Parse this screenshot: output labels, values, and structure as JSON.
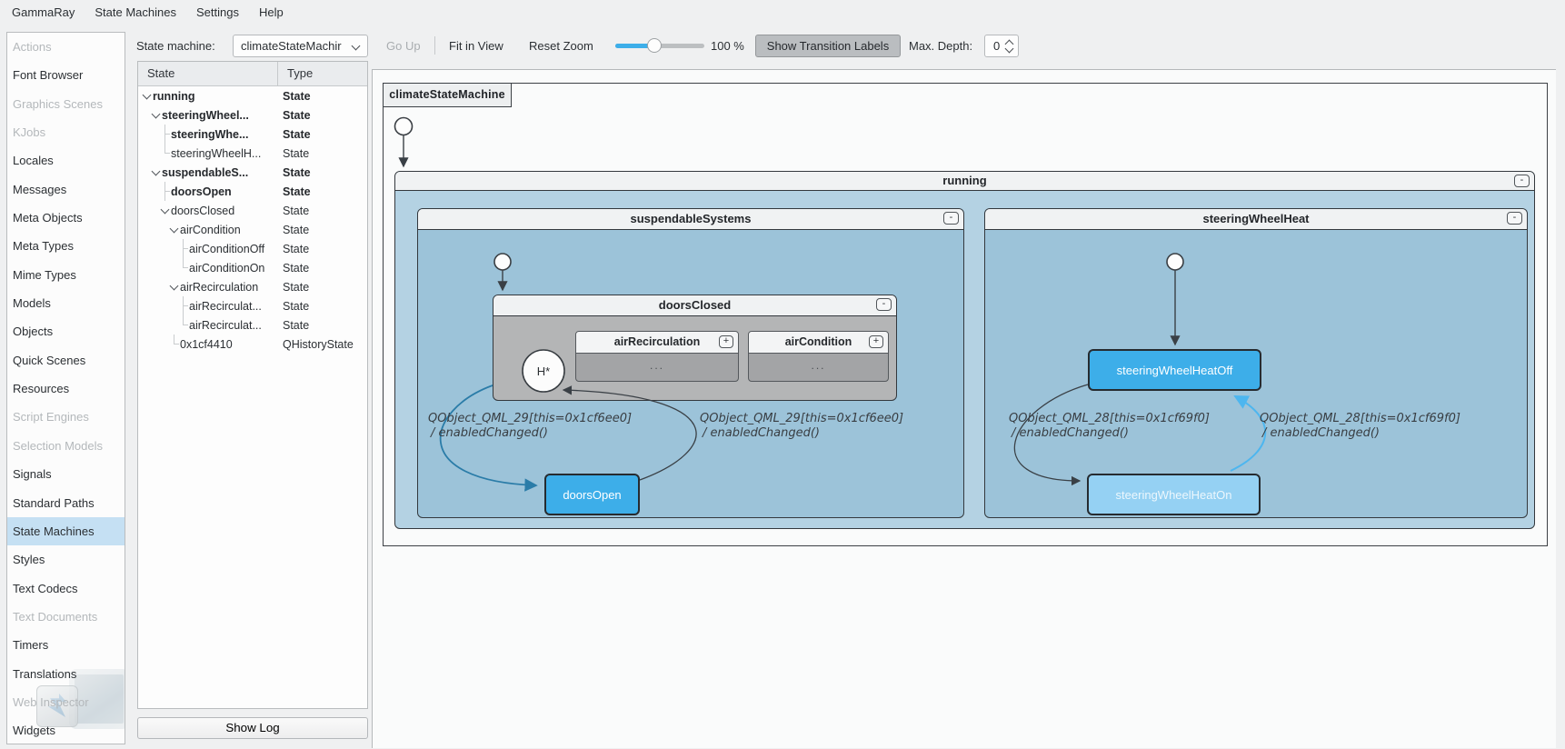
{
  "menubar": {
    "items": [
      {
        "label": "GammaRay"
      },
      {
        "label": "State Machines"
      },
      {
        "label": "Settings"
      },
      {
        "label": "Help"
      }
    ]
  },
  "sidebar": {
    "items": [
      {
        "label": "Actions",
        "enabled": false,
        "selected": false
      },
      {
        "label": "Font Browser",
        "enabled": true,
        "selected": false
      },
      {
        "label": "Graphics Scenes",
        "enabled": false,
        "selected": false
      },
      {
        "label": "KJobs",
        "enabled": false,
        "selected": false
      },
      {
        "label": "Locales",
        "enabled": true,
        "selected": false
      },
      {
        "label": "Messages",
        "enabled": true,
        "selected": false
      },
      {
        "label": "Meta Objects",
        "enabled": true,
        "selected": false
      },
      {
        "label": "Meta Types",
        "enabled": true,
        "selected": false
      },
      {
        "label": "Mime Types",
        "enabled": true,
        "selected": false
      },
      {
        "label": "Models",
        "enabled": true,
        "selected": false
      },
      {
        "label": "Objects",
        "enabled": true,
        "selected": false
      },
      {
        "label": "Quick Scenes",
        "enabled": true,
        "selected": false
      },
      {
        "label": "Resources",
        "enabled": true,
        "selected": false
      },
      {
        "label": "Script Engines",
        "enabled": false,
        "selected": false
      },
      {
        "label": "Selection Models",
        "enabled": false,
        "selected": false
      },
      {
        "label": "Signals",
        "enabled": true,
        "selected": false
      },
      {
        "label": "Standard Paths",
        "enabled": true,
        "selected": false
      },
      {
        "label": "State Machines",
        "enabled": true,
        "selected": true
      },
      {
        "label": "Styles",
        "enabled": true,
        "selected": false
      },
      {
        "label": "Text Codecs",
        "enabled": true,
        "selected": false
      },
      {
        "label": "Text Documents",
        "enabled": false,
        "selected": false
      },
      {
        "label": "Timers",
        "enabled": true,
        "selected": false
      },
      {
        "label": "Translations",
        "enabled": true,
        "selected": false
      },
      {
        "label": "Web Inspector",
        "enabled": false,
        "selected": false
      },
      {
        "label": "Widgets",
        "enabled": true,
        "selected": false
      }
    ]
  },
  "statepanel": {
    "combo_label": "State machine:",
    "combo_value": "climateStateMachir",
    "columns": {
      "state": "State",
      "type": "Type"
    },
    "rows": [
      {
        "label": "running",
        "type": "State",
        "depth": 0,
        "bold": true,
        "marker": "chev"
      },
      {
        "label": "steeringWheel...",
        "type": "State",
        "depth": 1,
        "bold": true,
        "marker": "chev"
      },
      {
        "label": "steeringWhe...",
        "type": "State",
        "depth": 2,
        "bold": true,
        "marker": "tee"
      },
      {
        "label": "steeringWheelH...",
        "type": "State",
        "depth": 2,
        "bold": false,
        "marker": "end"
      },
      {
        "label": "suspendableS...",
        "type": "State",
        "depth": 1,
        "bold": true,
        "marker": "chev"
      },
      {
        "label": "doorsOpen",
        "type": "State",
        "depth": 2,
        "bold": true,
        "marker": "tee"
      },
      {
        "label": "doorsClosed",
        "type": "State",
        "depth": 2,
        "bold": false,
        "marker": "chev"
      },
      {
        "label": "airCondition",
        "type": "State",
        "depth": 3,
        "bold": false,
        "marker": "chev"
      },
      {
        "label": "airConditionOff",
        "type": "State",
        "depth": 4,
        "bold": false,
        "marker": "tee"
      },
      {
        "label": "airConditionOn",
        "type": "State",
        "depth": 4,
        "bold": false,
        "marker": "end"
      },
      {
        "label": "airRecirculation",
        "type": "State",
        "depth": 3,
        "bold": false,
        "marker": "chev"
      },
      {
        "label": "airRecirculat...",
        "type": "State",
        "depth": 4,
        "bold": false,
        "marker": "tee"
      },
      {
        "label": "airRecirculat...",
        "type": "State",
        "depth": 4,
        "bold": false,
        "marker": "end"
      },
      {
        "label": "0x1cf4410",
        "type": "QHistoryState",
        "depth": 3,
        "bold": false,
        "marker": "end"
      }
    ],
    "show_log": "Show Log"
  },
  "toolbar": {
    "go_up": "Go Up",
    "fit_in_view": "Fit in View",
    "reset_zoom": "Reset Zoom",
    "zoom_value": "100 %",
    "show_transition_labels": "Show Transition Labels",
    "max_depth_label": "Max. Depth:",
    "max_depth_value": "0"
  },
  "diagram": {
    "machine_title": "climateStateMachine",
    "collapse_glyph": "-",
    "expand_glyph": "+",
    "ellipsis": "...",
    "states": {
      "running": "running",
      "suspendable": "suspendableSystems",
      "steering": "steeringWheelHeat",
      "doors_closed": "doorsClosed",
      "air_recirculation": "airRecirculation",
      "air_condition": "airCondition",
      "doors_open": "doorsOpen",
      "heat_off": "steeringWheelHeatOff",
      "heat_on": "steeringWheelHeatOn",
      "history": "H*"
    },
    "transitions": {
      "doors_label_line1": "QObject_QML_29[this=0x1cf6ee0]",
      "doors_label_line2": "/ enabledChanged()",
      "heat_label_line1": "QObject_QML_28[this=0x1cf69f0]",
      "heat_label_line2": "/ enabledChanged()"
    }
  },
  "colors": {
    "accent": "#3daee9",
    "active_state": "#3daee9",
    "inactive_state": "#95d1f3",
    "region_blue": "#9cc3d9",
    "running_blue": "#b4d2e3",
    "gray_region": "#b4b5b6",
    "collapsed_gray": "#a3a4a6",
    "selection": "#c5e0f3"
  }
}
